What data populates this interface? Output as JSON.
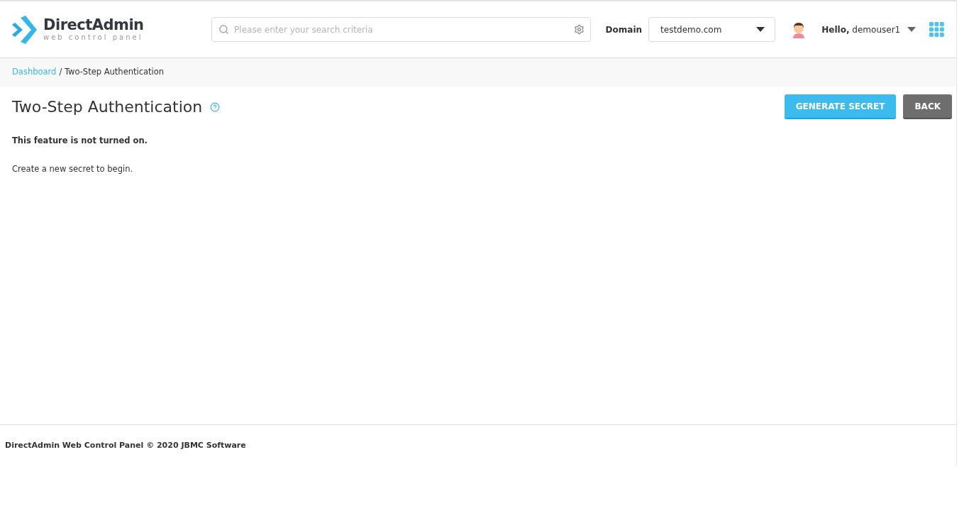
{
  "header": {
    "logo": {
      "name": "DirectAdmin",
      "tagline": "web control panel"
    },
    "search": {
      "placeholder": "Please enter your search criteria"
    },
    "domain": {
      "label": "Domain",
      "value": "testdemo.com"
    },
    "user": {
      "greeting": "Hello,",
      "name": "demouser1"
    }
  },
  "breadcrumb": [
    {
      "label": "Dashboard",
      "kind": "link"
    },
    {
      "label": "/ Two-Step Authentication",
      "kind": "current"
    }
  ],
  "page": {
    "title": "Two-Step Authentication",
    "buttons": [
      {
        "label": "GENERATE SECRET",
        "kind": "primary"
      },
      {
        "label": "BACK",
        "kind": "secondary"
      }
    ],
    "status": "This feature is not turned on.",
    "hint": "Create a new secret to begin."
  },
  "footer": "DirectAdmin Web Control Panel © 2020 JBMC Software"
}
